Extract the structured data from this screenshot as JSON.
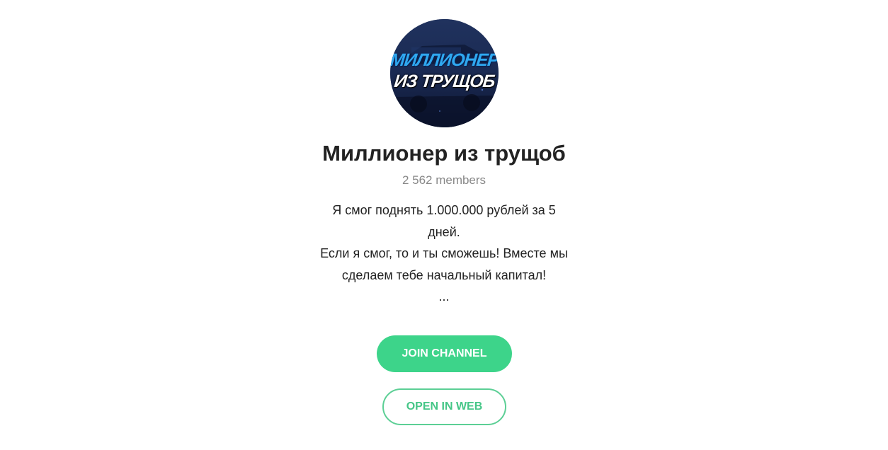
{
  "channel": {
    "avatar": {
      "logo_line1": "МИЛЛИОНЕР",
      "logo_line2": "ИЗ ТРУЩОБ"
    },
    "title": "Миллионер из трущоб",
    "members": "2 562 members",
    "description": [
      "Я смог поднять 1.000.000 рублей за 5",
      "дней.",
      "Если я смог, то и ты сможешь! Вместе мы",
      "сделаем тебе начальный капитал!",
      "..."
    ]
  },
  "actions": {
    "join_label": "JOIN CHANNEL",
    "web_label": "OPEN IN WEB"
  },
  "colors": {
    "accent": "#3dd48a",
    "accent_text": "#45c687",
    "title": "#222222",
    "muted": "#888888"
  }
}
